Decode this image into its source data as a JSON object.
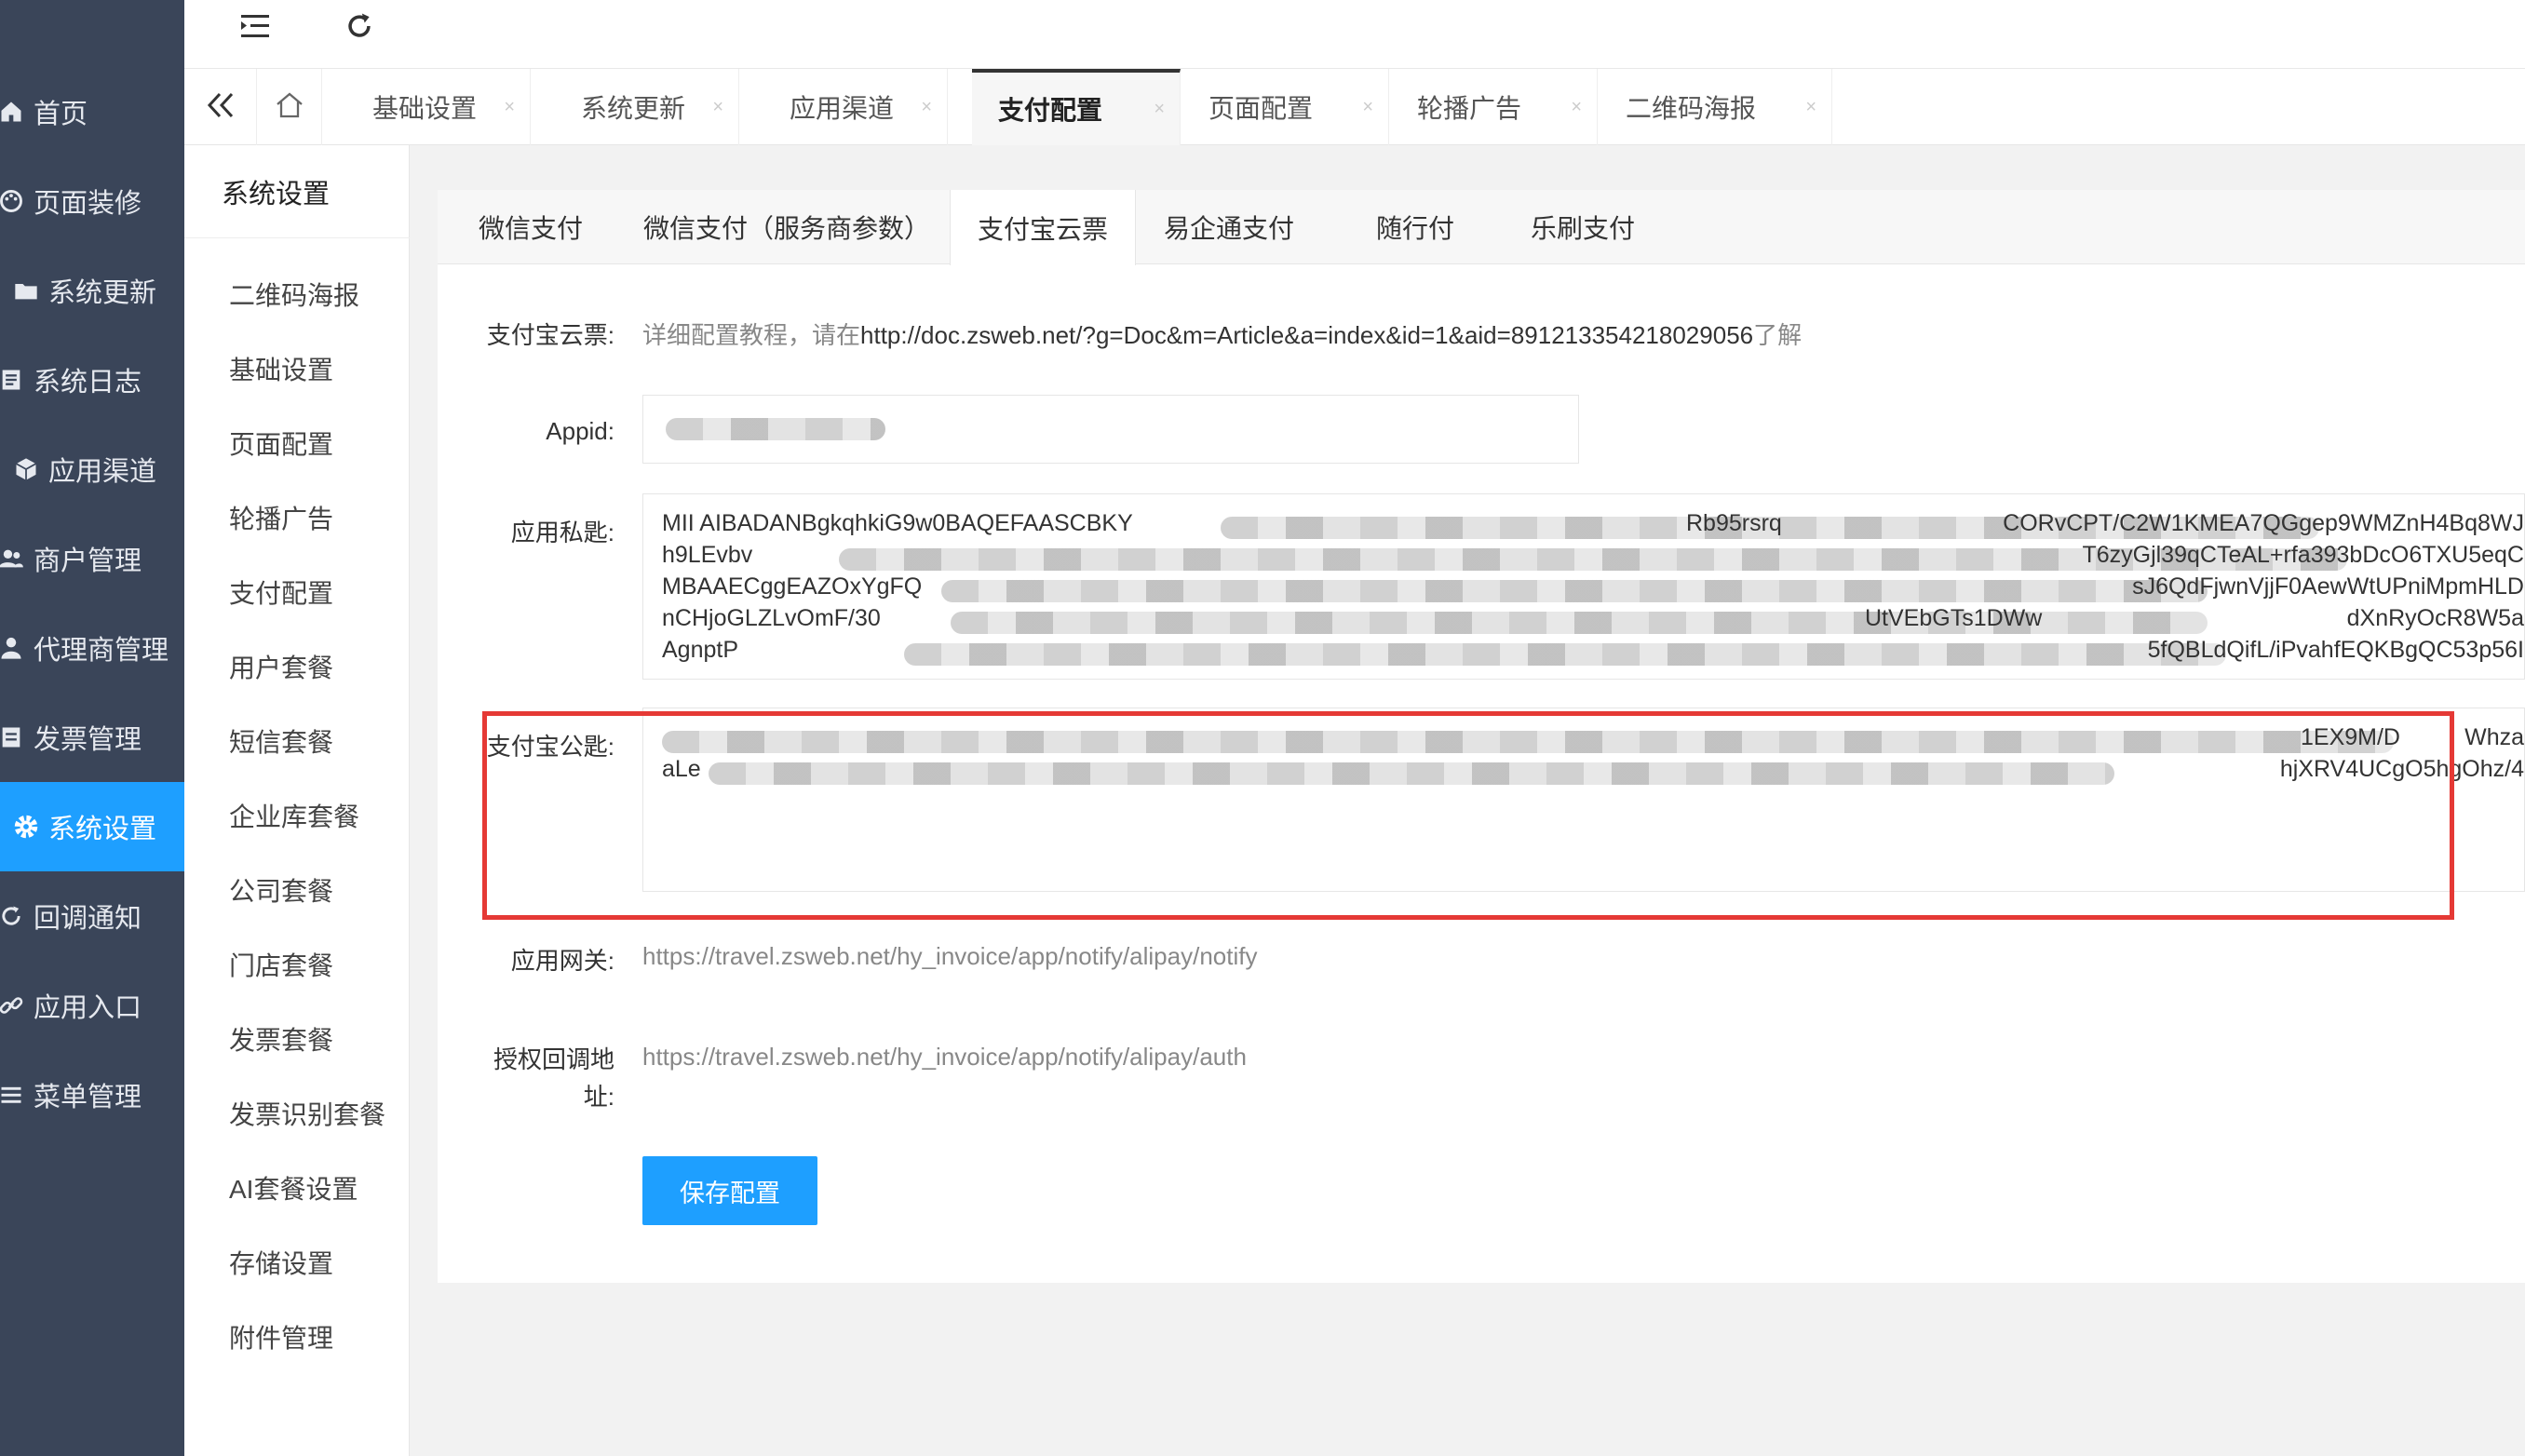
{
  "sidebar": {
    "items": [
      {
        "label": "首页",
        "icon": "home-icon"
      },
      {
        "label": "页面装修",
        "icon": "palette-icon"
      },
      {
        "label": "系统更新",
        "icon": "folder-icon"
      },
      {
        "label": "系统日志",
        "icon": "log-icon"
      },
      {
        "label": "应用渠道",
        "icon": "cube-icon"
      },
      {
        "label": "商户管理",
        "icon": "users-icon"
      },
      {
        "label": "代理商管理",
        "icon": "agent-icon"
      },
      {
        "label": "发票管理",
        "icon": "invoice-icon"
      },
      {
        "label": "系统设置",
        "icon": "gear-icon",
        "active": true
      },
      {
        "label": "回调通知",
        "icon": "refresh-icon"
      },
      {
        "label": "应用入口",
        "icon": "link-icon"
      },
      {
        "label": "菜单管理",
        "icon": "menu-icon"
      }
    ]
  },
  "tabs": {
    "items": [
      {
        "label": "基础设置"
      },
      {
        "label": "系统更新"
      },
      {
        "label": "应用渠道"
      },
      {
        "label": "支付配置",
        "active": true
      },
      {
        "label": "页面配置"
      },
      {
        "label": "轮播广告"
      },
      {
        "label": "二维码海报"
      }
    ],
    "close_glyph": "×"
  },
  "submenu": {
    "title": "系统设置",
    "items": [
      "二维码海报",
      "基础设置",
      "页面配置",
      "轮播广告",
      "支付配置",
      "用户套餐",
      "短信套餐",
      "企业库套餐",
      "公司套餐",
      "门店套餐",
      "发票套餐",
      "发票识别套餐",
      "AI套餐设置",
      "存储设置",
      "附件管理"
    ]
  },
  "paytabs": [
    "微信支付",
    "微信支付（服务商参数）",
    "支付宝云票",
    "易企通支付",
    "随行付",
    "乐刷支付"
  ],
  "form": {
    "intro_label": "支付宝云票:",
    "intro_prefix": "详细配置教程，请在",
    "intro_url": "http://doc.zsweb.net/?g=Doc&m=Article&a=index&id=1&aid=891213354218029056",
    "intro_suffix": "了解",
    "appid_label": "Appid:",
    "private_key_label": "应用私匙:",
    "private_key_lines": [
      "MII AIBADANBgkqhkiG9w0BAQEFAASCBKY",
      "h9LEvbv",
      "MBAAECggEAZOxYgFQ",
      "nCHjoGLZLvOmF/30",
      "AgnptP"
    ],
    "private_key_tail_lines": [
      "Rb95rsrq",
      "CORvCPT/C2W1KMEA7QGgep9WMZnH4Bq8WJ",
      "T6zyGjl39qCTeAL+rfa393bDcO6TXU5eqC",
      "sJ6QdFjwnVjjF0AewWtUPniMpmHLD",
      "UtVEbGTs1DWw",
      "dXnRyOcR8W5a",
      "5fQBLdQifL/iPvahfEQKBgQC53p56I"
    ],
    "public_key_label": "支付宝公匙:",
    "public_key_lines": [
      "",
      "aLe"
    ],
    "public_key_tail_lines": [
      "1EX9M/D",
      "Whza",
      "hjXRV4UCgO5hgOhz/4"
    ],
    "gateway_label": "应用网关:",
    "gateway_url": "https://travel.zsweb.net/hy_invoice/app/notify/alipay/notify",
    "auth_label_1": "授权回调地",
    "auth_label_2": "址:",
    "auth_url": "https://travel.zsweb.net/hy_invoice/app/notify/alipay/auth",
    "save_label": "保存配置"
  },
  "colors": {
    "sidebar_bg": "#3a4559",
    "active_blue": "#1e9fff",
    "highlight_red": "#e53935"
  }
}
